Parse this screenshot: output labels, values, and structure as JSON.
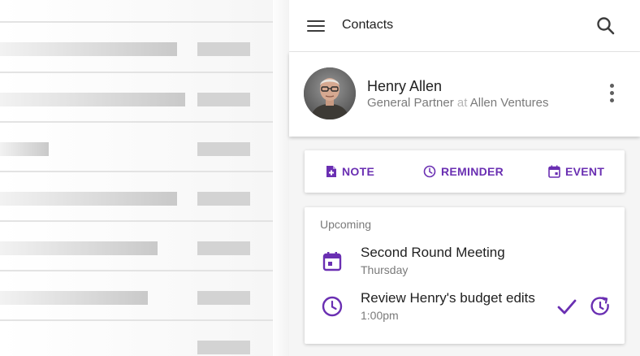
{
  "appbar": {
    "title": "Contacts",
    "menu_icon": "menu-icon",
    "search_icon": "search-icon"
  },
  "contact": {
    "name": "Henry Allen",
    "role": "General Partner",
    "connector": "at",
    "company": "Allen Ventures",
    "more_icon": "more-vert-icon"
  },
  "actions": [
    {
      "label": "NOTE",
      "icon": "note-add-icon"
    },
    {
      "label": "REMINDER",
      "icon": "clock-icon"
    },
    {
      "label": "EVENT",
      "icon": "calendar-event-icon"
    }
  ],
  "upcoming": {
    "label": "Upcoming",
    "items": [
      {
        "title": "Second Round Meeting",
        "subtitle": "Thursday",
        "icon": "calendar-icon"
      },
      {
        "title": "Review Henry's budget edits",
        "subtitle": "1:00pm",
        "icon": "clock-icon",
        "actions": [
          "check-icon",
          "snooze-icon"
        ]
      }
    ]
  },
  "colors": {
    "accent": "#6a2fb2",
    "background": "#f5f5f5",
    "surface": "#ffffff"
  }
}
